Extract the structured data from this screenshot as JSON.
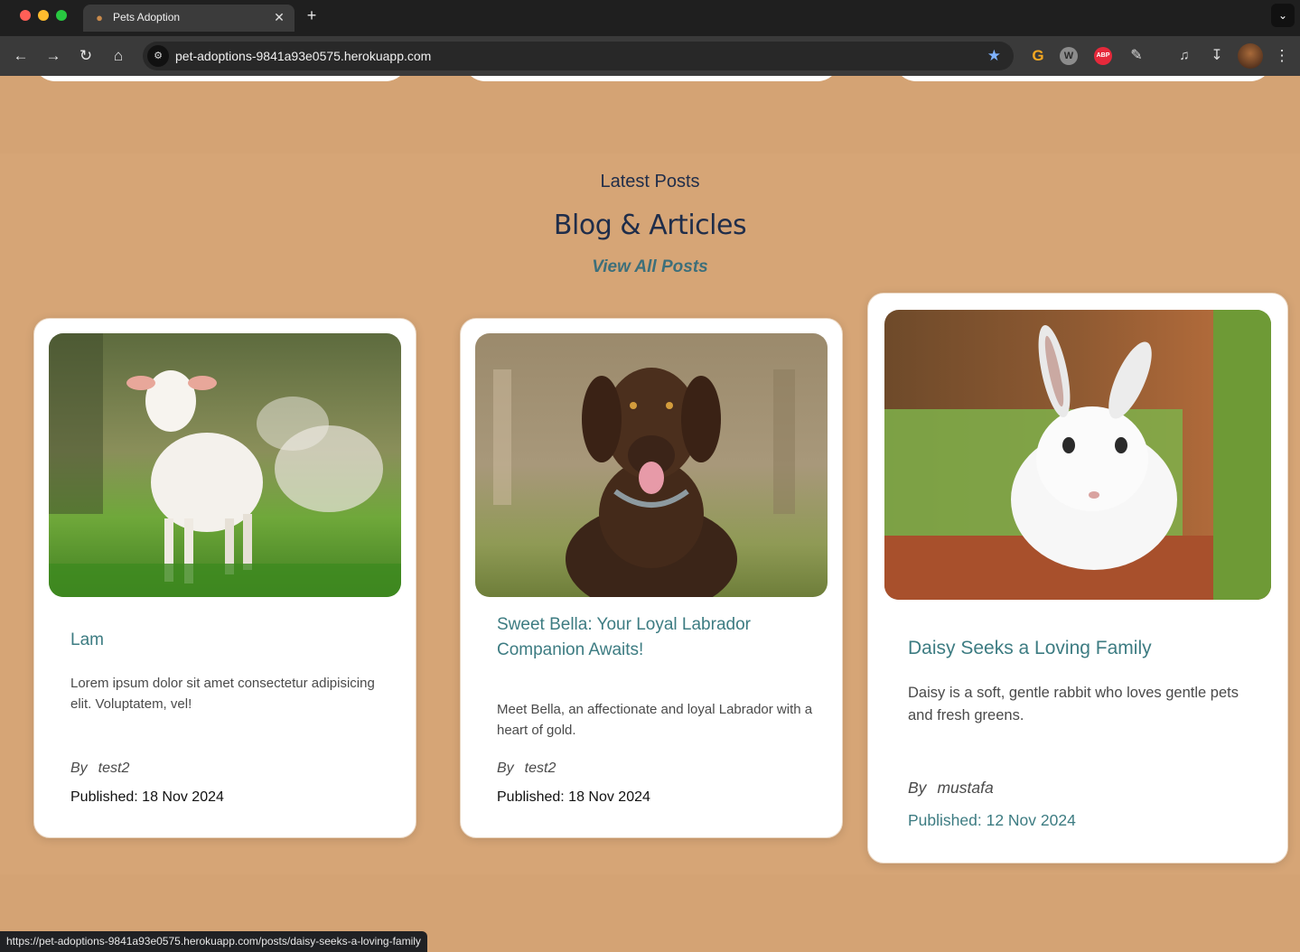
{
  "browser": {
    "tab_title": "Pets Adoption",
    "tab_favicon": "dog-favicon-icon",
    "url": "pet-adoptions-9841a93e0575.herokuapp.com",
    "status_url": "https://pet-adoptions-9841a93e0575.herokuapp.com/posts/daisy-seeks-a-loving-family",
    "extensions": {
      "abp_label": "ABP"
    }
  },
  "section": {
    "eyebrow": "Latest Posts",
    "title": "Blog & Articles",
    "view_all": "View All Posts"
  },
  "posts": [
    {
      "title": "Lam",
      "excerpt": "Lorem ipsum dolor sit amet consectetur adipisicing elit. Voluptatem, vel!",
      "by": "By",
      "author": "test2",
      "published": "Published: 18 Nov 2024",
      "image": "lamb-in-grass-photo"
    },
    {
      "title": "Sweet Bella: Your Loyal Labrador Companion Awaits!",
      "excerpt": "Meet Bella, an affectionate and loyal Labrador with a heart of gold.",
      "by": "By",
      "author": "test2",
      "published": "Published: 18 Nov 2024",
      "image": "chocolate-labrador-photo"
    },
    {
      "title": "Daisy Seeks a Loving Family",
      "excerpt": "Daisy is a soft, gentle rabbit who loves gentle pets and fresh greens.",
      "by": "By",
      "author": "mustafa",
      "published": "Published: 12 Nov 2024",
      "image": "white-rabbit-photo"
    }
  ],
  "colors": {
    "page_bg": "#d4a374",
    "title_color": "#1f2d4a",
    "accent": "#3d7c82"
  }
}
